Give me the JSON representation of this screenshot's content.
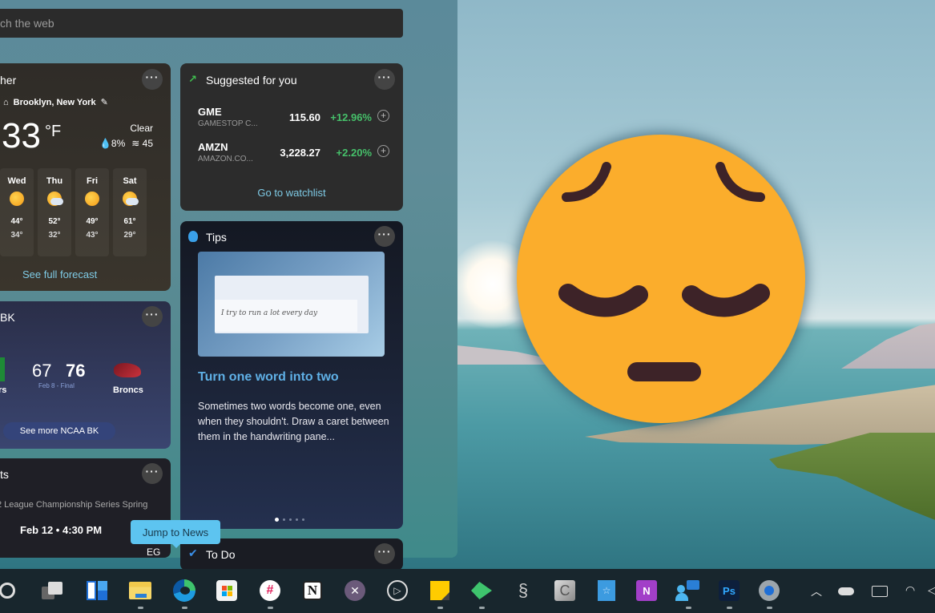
{
  "search": {
    "placeholder": "ch the web"
  },
  "weather": {
    "title": "her",
    "location": "Brooklyn, New York",
    "temperature": "33",
    "unit": "°F",
    "condition": "Clear",
    "precipitation": "8%",
    "wind": "45",
    "forecast": [
      {
        "day": "Wed",
        "icon": "sunny-icon",
        "high": "44°",
        "low": "34°"
      },
      {
        "day": "Thu",
        "icon": "partly-cloudy-icon",
        "high": "52°",
        "low": "32°"
      },
      {
        "day": "Fri",
        "icon": "sunny-icon",
        "high": "49°",
        "low": "43°"
      },
      {
        "day": "Sat",
        "icon": "partly-cloudy-icon",
        "high": "61°",
        "low": "29°"
      }
    ],
    "link": "See full forecast"
  },
  "sports": {
    "title": "BK",
    "team_left": "rs",
    "score_left": "67",
    "score_right": "76",
    "status": "Feb 8 - Final",
    "team_right": "Broncs",
    "more": "See more NCAA BK"
  },
  "esports": {
    "title": "ts",
    "league": "2 League Championship Series Spring",
    "when": "Feb 12 • 4:30 PM",
    "team": "EG"
  },
  "stocks": {
    "title": "Suggested for you",
    "items": [
      {
        "symbol": "GME",
        "name": "GAMESTOP C...",
        "price": "115.60",
        "change": "+12.96%"
      },
      {
        "symbol": "AMZN",
        "name": "AMAZON.CO...",
        "price": "3,228.27",
        "change": "+2.20%"
      }
    ],
    "link": "Go to watchlist",
    "positive_color": "#46c06a"
  },
  "tips": {
    "title": "Tips",
    "handwriting": "I try to run a lot every day",
    "headline": "Turn one word into two",
    "body": "Sometimes two words become one, even when they shouldn't. Draw a caret between them in the handwriting pane...",
    "pages": 5,
    "active_page": 1
  },
  "todo": {
    "title": "To Do"
  },
  "tooltip": {
    "text": "Jump to News"
  },
  "taskbar": {
    "apps": [
      {
        "name": "search",
        "running": false
      },
      {
        "name": "task-view",
        "running": false
      },
      {
        "name": "widgets",
        "running": false
      },
      {
        "name": "file-explorer",
        "running": true
      },
      {
        "name": "edge",
        "running": true
      },
      {
        "name": "microsoft-store",
        "running": false
      },
      {
        "name": "slack",
        "running": true
      },
      {
        "name": "notion",
        "running": false
      },
      {
        "name": "app-purple",
        "running": false
      },
      {
        "name": "app-play-circle",
        "running": false
      },
      {
        "name": "sticky-notes",
        "running": true
      },
      {
        "name": "app-green-arrow",
        "running": true
      },
      {
        "name": "app-waves",
        "running": false
      },
      {
        "name": "app-gray-c",
        "running": false
      },
      {
        "name": "app-blue-book",
        "running": false
      },
      {
        "name": "onenote",
        "running": false
      },
      {
        "name": "people-chat",
        "running": true
      },
      {
        "name": "photoshop",
        "running": true
      },
      {
        "name": "settings",
        "running": true
      }
    ],
    "tray": [
      "chevron-up",
      "onedrive",
      "keyboard",
      "wifi",
      "volume"
    ]
  }
}
